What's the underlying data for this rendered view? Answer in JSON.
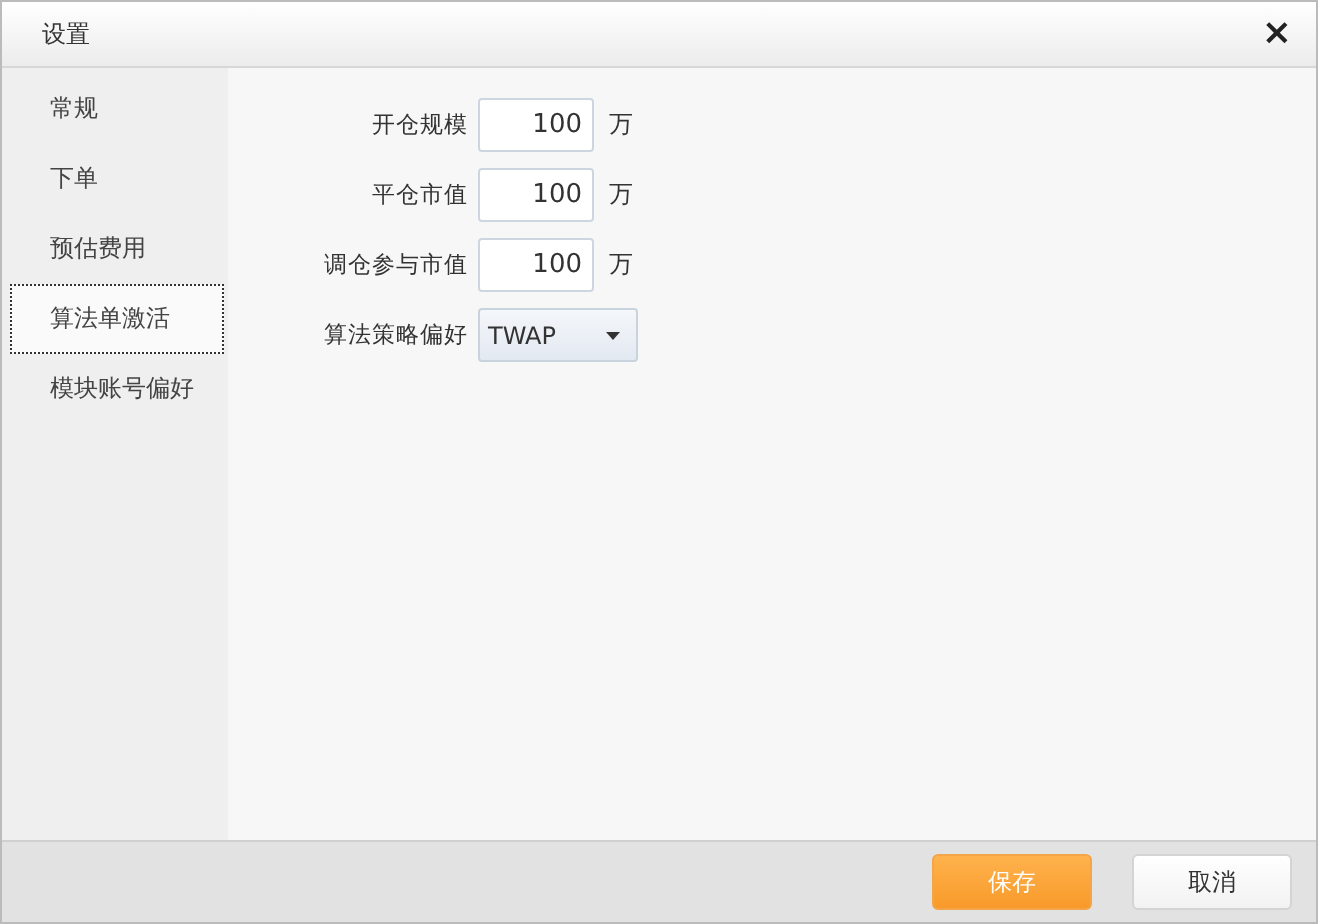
{
  "window": {
    "title": "设置",
    "close": "×"
  },
  "sidebar": {
    "items": [
      {
        "label": "常规",
        "selected": false
      },
      {
        "label": "下单",
        "selected": false
      },
      {
        "label": "预估费用",
        "selected": false
      },
      {
        "label": "算法单激活",
        "selected": true
      },
      {
        "label": "模块账号偏好",
        "selected": false
      }
    ]
  },
  "form": {
    "fields": [
      {
        "kind": "number",
        "label": "开仓规模",
        "value": "100",
        "unit": "万"
      },
      {
        "kind": "number",
        "label": "平仓市值",
        "value": "100",
        "unit": "万"
      },
      {
        "kind": "number",
        "label": "调仓参与市值",
        "value": "100",
        "unit": "万"
      },
      {
        "kind": "dropdown",
        "label": "算法策略偏好",
        "value": "TWAP"
      }
    ]
  },
  "buttons": [
    {
      "label": "保存",
      "primary": true
    },
    {
      "label": "取消",
      "primary": false
    }
  ]
}
